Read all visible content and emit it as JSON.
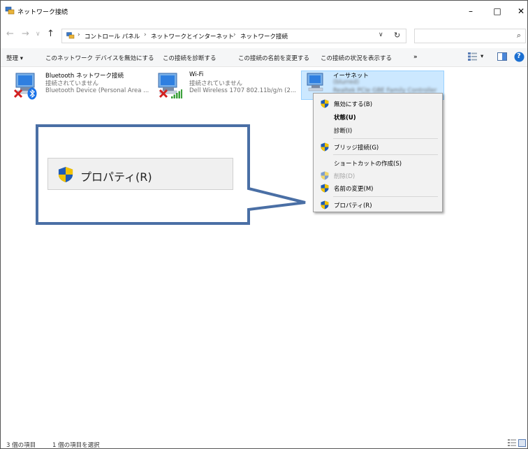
{
  "window": {
    "title": "ネットワーク接続",
    "controls": {
      "minimize": "–",
      "maximize": "□",
      "close": "✕"
    }
  },
  "address": {
    "back": "←",
    "forward": "→",
    "recent": "∨",
    "up": "↑",
    "breadcrumbs": [
      "コントロール パネル",
      "ネットワークとインターネット",
      "ネットワーク接続"
    ],
    "separator": "›",
    "dropdown": "∨",
    "refresh": "↻",
    "search_placeholder": "",
    "search_icon": "⌕"
  },
  "commandbar": {
    "items": [
      "整理 ▾",
      "このネットワーク デバイスを無効にする",
      "この接続を診断する",
      "この接続の名前を変更する",
      "この接続の状況を表示する",
      "»"
    ],
    "view_dropdown": "▾",
    "help": "?"
  },
  "connections": [
    {
      "name": "Bluetooth ネットワーク接続",
      "status": "接続されていません",
      "device": "Bluetooth Device (Personal Area ..."
    },
    {
      "name": "Wi-Fi",
      "status": "接続されていません",
      "device": "Dell Wireless 1707 802.11b/g/n (2..."
    },
    {
      "name": "イーサネット",
      "status": "(blurred)",
      "device": "Realtek PCIe GBE Family Controller"
    }
  ],
  "context_menu": {
    "items": [
      {
        "label": "無効にする(B)",
        "shield": true,
        "bold": false,
        "disabled": false
      },
      {
        "label": "状態(U)",
        "shield": false,
        "bold": true,
        "disabled": false
      },
      {
        "label": "診断(I)",
        "shield": false,
        "bold": false,
        "disabled": false
      },
      {
        "label": "ブリッジ接続(G)",
        "shield": true,
        "bold": false,
        "disabled": false
      },
      {
        "label": "ショートカットの作成(S)",
        "shield": false,
        "bold": false,
        "disabled": false
      },
      {
        "label": "削除(D)",
        "shield": true,
        "bold": false,
        "disabled": true
      },
      {
        "label": "名前の変更(M)",
        "shield": true,
        "bold": false,
        "disabled": false
      },
      {
        "label": "プロパティ(R)",
        "shield": true,
        "bold": false,
        "disabled": false
      }
    ]
  },
  "callout": {
    "label": "プロパティ(R)",
    "border_color": "#4a6fa5"
  },
  "status": {
    "count": "3 個の項目",
    "selected": "1 個の項目を選択"
  },
  "colors": {
    "selection_bg": "#cce8ff",
    "shield_blue": "#1f5bb5",
    "shield_yellow": "#f2c200",
    "error_red": "#d32020"
  }
}
